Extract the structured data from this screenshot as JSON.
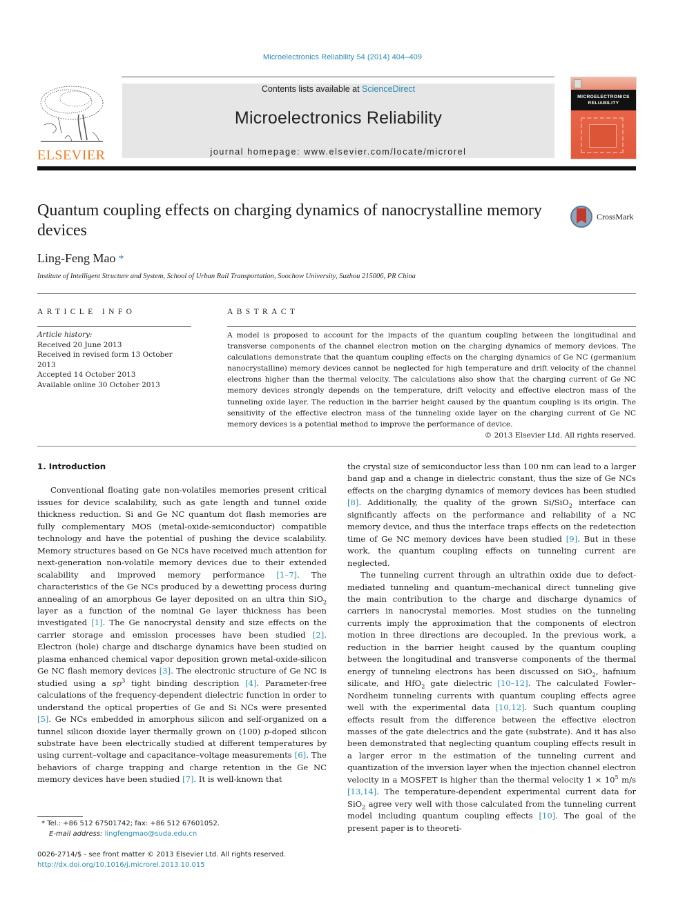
{
  "header": {
    "citation": "Microelectronics Reliability 54 (2014) 404–409",
    "contents_prefix": "Contents lists available at ",
    "contents_link": "ScienceDirect",
    "journal_title": "Microelectronics Reliability",
    "homepage_prefix": "journal homepage: ",
    "homepage_url": "www.elsevier.com/locate/microrel",
    "publisher_logo_text": "ELSEVIER",
    "cover_title_line1": "MICROELECTRONICS",
    "cover_title_line2": "RELIABILITY",
    "colors": {
      "link": "#2a8ab8",
      "elsevier_orange": "#f07a1e",
      "cover_orange": "#e2593c"
    }
  },
  "article": {
    "title": "Quantum coupling effects on charging dynamics of nanocrystalline memory devices",
    "crossmark_label": "CrossMark",
    "author": "Ling-Feng Mao",
    "author_mark": "*",
    "affiliation": "Institute of Intelligent Structure and System, School of Urban Rail Transportation, Soochow University, Suzhou 215006, PR China"
  },
  "article_info": {
    "heading": "ARTICLE INFO",
    "history_label": "Article history:",
    "history": [
      "Received 20 June 2013",
      "Received in revised form 13 October 2013",
      "Accepted 14 October 2013",
      "Available online 30 October 2013"
    ]
  },
  "abstract": {
    "heading": "ABSTRACT",
    "text": "A model is proposed to account for the impacts of the quantum coupling between the longitudinal and transverse components of the channel electron motion on the charging dynamics of memory devices. The calculations demonstrate that the quantum coupling effects on the charging dynamics of Ge NC (germanium nanocrystalline) memory devices cannot be neglected for high temperature and drift velocity of the channel electrons higher than the thermal velocity. The calculations also show that the charging current of Ge NC memory devices strongly depends on the temperature, drift velocity and effective electron mass of the tunneling oxide layer. The reduction in the barrier height caused by the quantum coupling is its origin. The sensitivity of the effective electron mass of the tunneling oxide layer on the charging current of Ge NC memory devices is a potential method to improve the performance of device.",
    "copyright": "© 2013 Elsevier Ltd. All rights reserved."
  },
  "body": {
    "section_heading": "1. Introduction",
    "paragraphs": [
      [
        {
          "t": "Conventional floating gate non-volatiles memories present critical issues for device scalability, such as gate length and tunnel oxide thickness reduction. Si and Ge NC quantum dot flash memories are fully complementary MOS (metal-oxide-semiconductor) compatible technology and have the potential of pushing the device scalability. Memory structures based on Ge NCs have received much attention for next-generation non-volatile memory devices due to their extended scalability and improved memory performance "
        },
        {
          "link": "[1–7]"
        },
        {
          "t": ". The characteristics of the Ge NCs produced by a dewetting process during annealing of an amorphous Ge layer deposited on an ultra thin SiO"
        },
        {
          "sub": "2"
        },
        {
          "t": " layer as a function of the nominal Ge layer thickness has been investigated "
        },
        {
          "link": "[1]"
        },
        {
          "t": ". The Ge nanocrystal density and size effects on the carrier storage and emission processes have been studied "
        },
        {
          "link": "[2]"
        },
        {
          "t": ". Electron (hole) charge and discharge dynamics have been studied on plasma enhanced chemical vapor deposition grown metal-oxide-silicon Ge NC flash memory devices "
        },
        {
          "link": "[3]"
        },
        {
          "t": ". The electronic structure of Ge NC is studied using a "
        },
        {
          "i": "sp"
        },
        {
          "sup": "3"
        },
        {
          "t": " tight binding description "
        },
        {
          "link": "[4]"
        },
        {
          "t": ". Parameter-free calculations of the frequency-dependent dielectric function in order to understand the optical properties of Ge and Si NCs were presented "
        },
        {
          "link": "[5]"
        },
        {
          "t": ". Ge NCs embedded in amorphous silicon and self-organized on a tunnel silicon dioxide layer thermally grown on (100) "
        },
        {
          "i": "p"
        },
        {
          "t": "-doped silicon substrate have been electrically studied at different temperatures by using current–voltage and capacitance–voltage measurements "
        },
        {
          "link": "[6]"
        },
        {
          "t": ". The behaviors of charge trapping and charge retention in the Ge NC memory devices have been studied "
        },
        {
          "link": "[7]"
        },
        {
          "t": ". It is well-known that the crystal size of semiconductor less than 100 nm can lead to a larger band gap and a change in dielectric constant, thus the size of Ge NCs effects on the charging dynamics of memory devices has been studied "
        },
        {
          "link": "[8]"
        },
        {
          "t": ". Additionally, the quality of the grown Si/SiO"
        },
        {
          "sub": "2"
        },
        {
          "t": " interface can significantly affects on the performance and reliability of a NC memory device, and thus the interface traps effects on the redetection time of Ge NC memory devices have been studied "
        },
        {
          "link": "[9]"
        },
        {
          "t": ". But in these work, the quantum coupling effects on tunneling current are neglected."
        }
      ],
      [
        {
          "t": "The tunneling current through an ultrathin oxide due to defect-mediated tunneling and quantum–mechanical direct tunneling give the main contribution to the charge and discharge dynamics of carriers in nanocrystal memories. Most studies on the tunneling currents imply the approximation that the components of electron motion in three directions are decoupled. In the previous work, a reduction in the barrier height caused by the quantum coupling between the longitudinal and transverse components of the thermal energy of tunneling electrons has been discussed on SiO"
        },
        {
          "sub": "2"
        },
        {
          "t": ", hafnium silicate, and HfO"
        },
        {
          "sub": "2"
        },
        {
          "t": " gate dielectric "
        },
        {
          "link": "[10–12]"
        },
        {
          "t": ". The calculated Fowler–Nordheim tunneling currents with quantum coupling effects agree well with the experimental data "
        },
        {
          "link": "[10,12]"
        },
        {
          "t": ". Such quantum coupling effects result from the difference between the effective electron masses of the gate dielectrics and the gate (substrate). And it has also been demonstrated that neglecting quantum coupling effects result in a larger error in the estimation of the tunneling current and quantization of the inversion layer when the injection channel electron velocity in a MOSFET is higher than the thermal velocity 1 × 10"
        },
        {
          "sup": "5"
        },
        {
          "t": " m/s "
        },
        {
          "link": "[13,14]"
        },
        {
          "t": ". The temperature-dependent experimental current data for SiO"
        },
        {
          "sub": "2"
        },
        {
          "t": " agree very well with those calculated from the tunneling current model including quantum coupling effects "
        },
        {
          "link": "[10]"
        },
        {
          "t": ". The goal of the present paper is to theoreti-"
        }
      ]
    ],
    "split_marker": "It is well-known that"
  },
  "footnote": {
    "mark": "*",
    "contact": "Tel.: +86 512 67501742; fax: +86 512 67601052.",
    "email_label": "E-mail address:",
    "email": "lingfengmao@suda.edu.cn"
  },
  "front_matter": {
    "issn_line": "0026-2714/$ - see front matter © 2013 Elsevier Ltd. All rights reserved.",
    "doi": "http://dx.doi.org/10.1016/j.microrel.2013.10.015"
  }
}
